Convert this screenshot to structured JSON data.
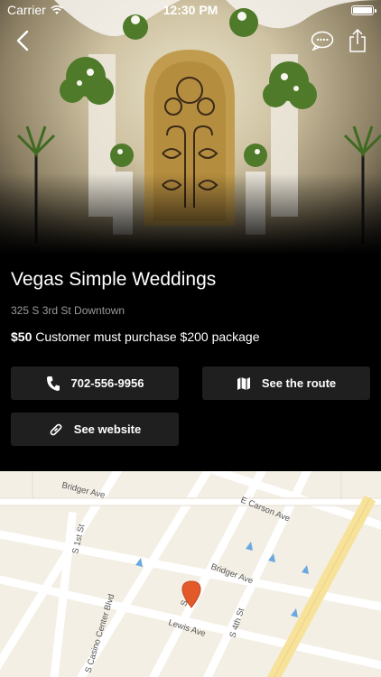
{
  "status_bar": {
    "carrier": "Carrier",
    "time": "12:30 PM"
  },
  "nav": {
    "back_icon": "chevron-left-icon",
    "chat_icon": "chat-bubble-icon",
    "share_icon": "share-icon"
  },
  "venue": {
    "name": "Vegas Simple Weddings",
    "address": "325 S 3rd St Downtown",
    "price": "$50",
    "price_note": " Customer must purchase $200 package"
  },
  "actions": {
    "phone": "702-556-9956",
    "route": "See the route",
    "website": "See website"
  },
  "map": {
    "streets": {
      "bridger_top": "Bridger Ave",
      "carson": "E Carson Ave",
      "first": "S 1st St",
      "bridger": "Bridger Ave",
      "casino": "S Casino Center Blvd",
      "fourth": "S 4th St",
      "lewis": "Lewis Ave",
      "third_abbr": "S"
    },
    "pin_color": "#e35a2a"
  },
  "colors": {
    "background": "#000000",
    "button": "#1f1f1f",
    "map_bg": "#f4efe4"
  }
}
